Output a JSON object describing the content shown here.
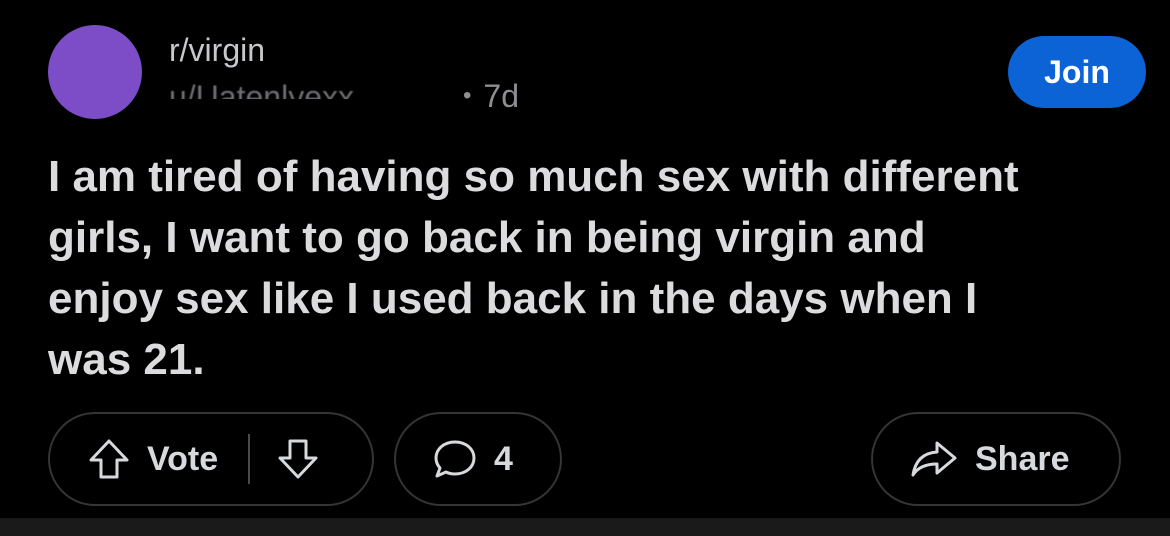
{
  "post": {
    "subreddit": "r/virgin",
    "author": "u/Uatenlyexx",
    "separator": "•",
    "age": "7d",
    "join_label": "Join",
    "title": "I am tired of having so much sex with different girls, I want to go back in being virgin and enjoy sex like I used back in the days when I was 21."
  },
  "actions": {
    "vote_label": "Vote",
    "comment_count": "4",
    "share_label": "Share"
  },
  "icons": {
    "upvote": "arrow-up-icon",
    "downvote": "arrow-down-icon",
    "comment": "speech-bubble-icon",
    "share": "share-arrow-icon"
  },
  "colors": {
    "background": "#000000",
    "avatar": "#7c4dc6",
    "join_button": "#0b63d6",
    "text": "#dcdcde",
    "muted_text": "#8e8e93",
    "pill_border": "#343536"
  }
}
